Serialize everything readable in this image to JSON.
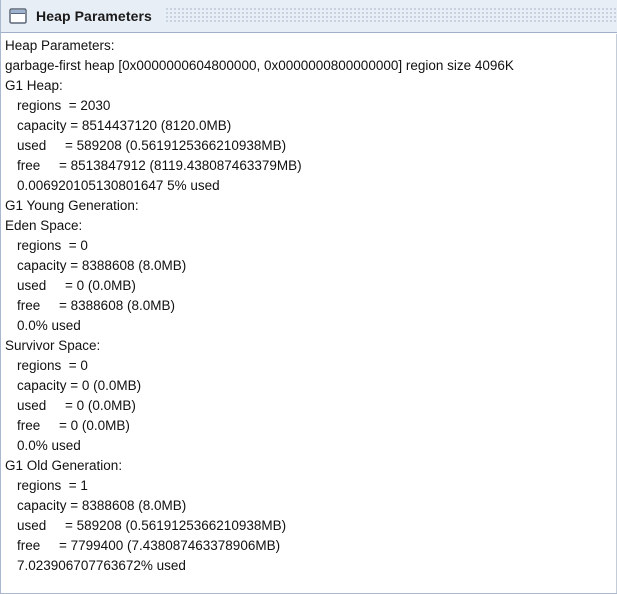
{
  "window": {
    "title": "Heap Parameters",
    "icon": "window-icon"
  },
  "lines": [
    {
      "text": "Heap Parameters:",
      "indent": 0
    },
    {
      "text": "garbage-first heap [0x0000000604800000, 0x0000000800000000] region size 4096K",
      "indent": 0
    },
    {
      "text": "G1 Heap:",
      "indent": 0
    },
    {
      "text": "regions  = 2030",
      "indent": 1
    },
    {
      "text": "capacity = 8514437120 (8120.0MB)",
      "indent": 1
    },
    {
      "text": "used     = 589208 (0.5619125366210938MB)",
      "indent": 1
    },
    {
      "text": "free     = 8513847912 (8119.438087463379MB)",
      "indent": 1
    },
    {
      "text": "0.006920105130801647 5% used",
      "indent": 1
    },
    {
      "text": "G1 Young Generation:",
      "indent": 0
    },
    {
      "text": "Eden Space:",
      "indent": 0
    },
    {
      "text": "regions  = 0",
      "indent": 1
    },
    {
      "text": "capacity = 8388608 (8.0MB)",
      "indent": 1
    },
    {
      "text": "used     = 0 (0.0MB)",
      "indent": 1
    },
    {
      "text": "free     = 8388608 (8.0MB)",
      "indent": 1
    },
    {
      "text": "0.0% used",
      "indent": 1
    },
    {
      "text": "Survivor Space:",
      "indent": 0
    },
    {
      "text": "regions  = 0",
      "indent": 1
    },
    {
      "text": "capacity = 0 (0.0MB)",
      "indent": 1
    },
    {
      "text": "used     = 0 (0.0MB)",
      "indent": 1
    },
    {
      "text": "free     = 0 (0.0MB)",
      "indent": 1
    },
    {
      "text": "0.0% used",
      "indent": 1
    },
    {
      "text": "G1 Old Generation:",
      "indent": 0
    },
    {
      "text": "regions  = 1",
      "indent": 1
    },
    {
      "text": "capacity = 8388608 (8.0MB)",
      "indent": 1
    },
    {
      "text": "used     = 589208 (0.5619125366210938MB)",
      "indent": 1
    },
    {
      "text": "free     = 7799400 (7.438087463378906MB)",
      "indent": 1
    },
    {
      "text": "7.023906707763672% used",
      "indent": 1
    }
  ]
}
